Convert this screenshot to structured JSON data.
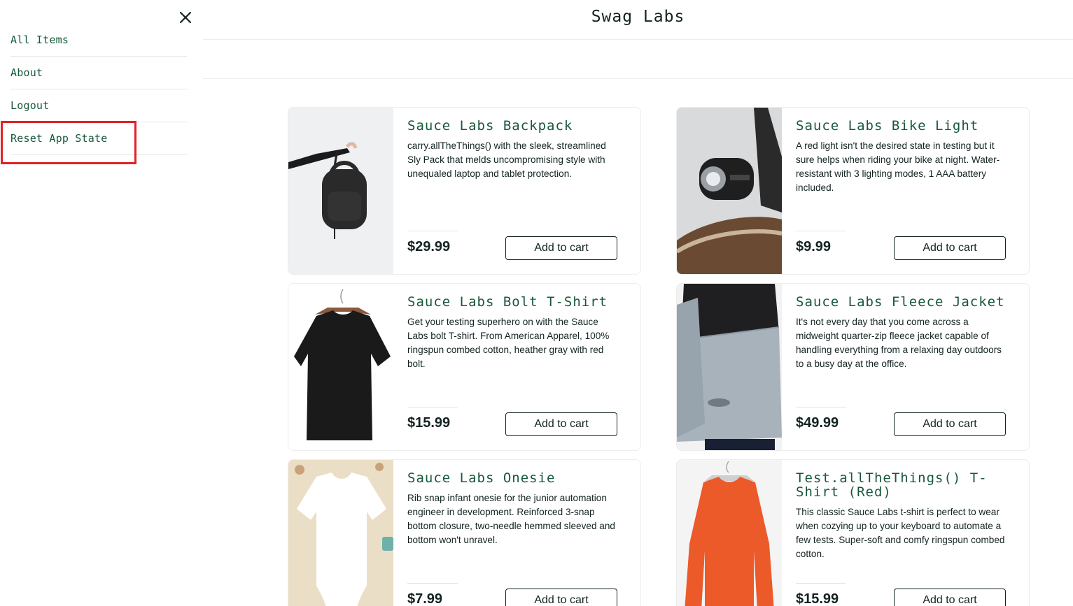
{
  "menu": {
    "items": [
      {
        "label": "All Items"
      },
      {
        "label": "About"
      },
      {
        "label": "Logout"
      },
      {
        "label": "Reset App State"
      }
    ]
  },
  "header": {
    "logo": "Swag Labs"
  },
  "products": [
    {
      "name": "Sauce Labs Backpack",
      "description": "carry.allTheThings() with the sleek, streamlined Sly Pack that melds uncompromising style with unequaled laptop and tablet protection.",
      "price": "$29.99",
      "button": "Add to cart"
    },
    {
      "name": "Sauce Labs Bike Light",
      "description": "A red light isn't the desired state in testing but it sure helps when riding your bike at night. Water-resistant with 3 lighting modes, 1 AAA battery included.",
      "price": "$9.99",
      "button": "Add to cart"
    },
    {
      "name": "Sauce Labs Bolt T-Shirt",
      "description": "Get your testing superhero on with the Sauce Labs bolt T-shirt. From American Apparel, 100% ringspun combed cotton, heather gray with red bolt.",
      "price": "$15.99",
      "button": "Add to cart"
    },
    {
      "name": "Sauce Labs Fleece Jacket",
      "description": "It's not every day that you come across a midweight quarter-zip fleece jacket capable of handling everything from a relaxing day outdoors to a busy day at the office.",
      "price": "$49.99",
      "button": "Add to cart"
    },
    {
      "name": "Sauce Labs Onesie",
      "description": "Rib snap infant onesie for the junior automation engineer in development. Reinforced 3-snap bottom closure, two-needle hemmed sleeved and bottom won't unravel.",
      "price": "$7.99",
      "button": "Add to cart"
    },
    {
      "name": "Test.allTheThings() T-Shirt (Red)",
      "description": "This classic Sauce Labs t-shirt is perfect to wear when cozying up to your keyboard to automate a few tests. Super-soft and comfy ringspun combed cotton.",
      "price": "$15.99",
      "button": "Add to cart"
    }
  ],
  "colors": {
    "accent": "#18583a",
    "text": "#132322",
    "highlight": "#e32124"
  }
}
